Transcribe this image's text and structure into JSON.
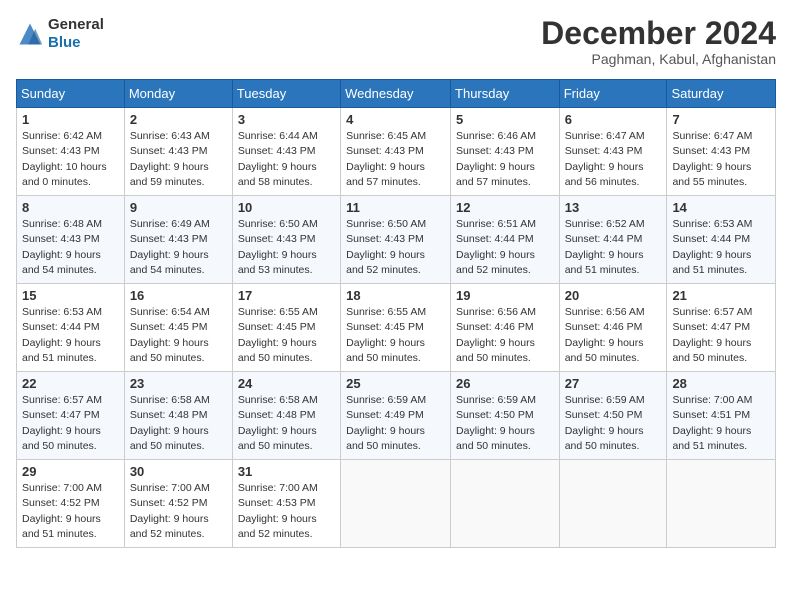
{
  "header": {
    "logo_line1": "General",
    "logo_line2": "Blue",
    "month": "December 2024",
    "location": "Paghman, Kabul, Afghanistan"
  },
  "weekdays": [
    "Sunday",
    "Monday",
    "Tuesday",
    "Wednesday",
    "Thursday",
    "Friday",
    "Saturday"
  ],
  "weeks": [
    [
      {
        "day": "1",
        "sunrise": "6:42 AM",
        "sunset": "4:43 PM",
        "daylight": "10 hours and 0 minutes."
      },
      {
        "day": "2",
        "sunrise": "6:43 AM",
        "sunset": "4:43 PM",
        "daylight": "9 hours and 59 minutes."
      },
      {
        "day": "3",
        "sunrise": "6:44 AM",
        "sunset": "4:43 PM",
        "daylight": "9 hours and 58 minutes."
      },
      {
        "day": "4",
        "sunrise": "6:45 AM",
        "sunset": "4:43 PM",
        "daylight": "9 hours and 57 minutes."
      },
      {
        "day": "5",
        "sunrise": "6:46 AM",
        "sunset": "4:43 PM",
        "daylight": "9 hours and 57 minutes."
      },
      {
        "day": "6",
        "sunrise": "6:47 AM",
        "sunset": "4:43 PM",
        "daylight": "9 hours and 56 minutes."
      },
      {
        "day": "7",
        "sunrise": "6:47 AM",
        "sunset": "4:43 PM",
        "daylight": "9 hours and 55 minutes."
      }
    ],
    [
      {
        "day": "8",
        "sunrise": "6:48 AM",
        "sunset": "4:43 PM",
        "daylight": "9 hours and 54 minutes."
      },
      {
        "day": "9",
        "sunrise": "6:49 AM",
        "sunset": "4:43 PM",
        "daylight": "9 hours and 54 minutes."
      },
      {
        "day": "10",
        "sunrise": "6:50 AM",
        "sunset": "4:43 PM",
        "daylight": "9 hours and 53 minutes."
      },
      {
        "day": "11",
        "sunrise": "6:50 AM",
        "sunset": "4:43 PM",
        "daylight": "9 hours and 52 minutes."
      },
      {
        "day": "12",
        "sunrise": "6:51 AM",
        "sunset": "4:44 PM",
        "daylight": "9 hours and 52 minutes."
      },
      {
        "day": "13",
        "sunrise": "6:52 AM",
        "sunset": "4:44 PM",
        "daylight": "9 hours and 51 minutes."
      },
      {
        "day": "14",
        "sunrise": "6:53 AM",
        "sunset": "4:44 PM",
        "daylight": "9 hours and 51 minutes."
      }
    ],
    [
      {
        "day": "15",
        "sunrise": "6:53 AM",
        "sunset": "4:44 PM",
        "daylight": "9 hours and 51 minutes."
      },
      {
        "day": "16",
        "sunrise": "6:54 AM",
        "sunset": "4:45 PM",
        "daylight": "9 hours and 50 minutes."
      },
      {
        "day": "17",
        "sunrise": "6:55 AM",
        "sunset": "4:45 PM",
        "daylight": "9 hours and 50 minutes."
      },
      {
        "day": "18",
        "sunrise": "6:55 AM",
        "sunset": "4:45 PM",
        "daylight": "9 hours and 50 minutes."
      },
      {
        "day": "19",
        "sunrise": "6:56 AM",
        "sunset": "4:46 PM",
        "daylight": "9 hours and 50 minutes."
      },
      {
        "day": "20",
        "sunrise": "6:56 AM",
        "sunset": "4:46 PM",
        "daylight": "9 hours and 50 minutes."
      },
      {
        "day": "21",
        "sunrise": "6:57 AM",
        "sunset": "4:47 PM",
        "daylight": "9 hours and 50 minutes."
      }
    ],
    [
      {
        "day": "22",
        "sunrise": "6:57 AM",
        "sunset": "4:47 PM",
        "daylight": "9 hours and 50 minutes."
      },
      {
        "day": "23",
        "sunrise": "6:58 AM",
        "sunset": "4:48 PM",
        "daylight": "9 hours and 50 minutes."
      },
      {
        "day": "24",
        "sunrise": "6:58 AM",
        "sunset": "4:48 PM",
        "daylight": "9 hours and 50 minutes."
      },
      {
        "day": "25",
        "sunrise": "6:59 AM",
        "sunset": "4:49 PM",
        "daylight": "9 hours and 50 minutes."
      },
      {
        "day": "26",
        "sunrise": "6:59 AM",
        "sunset": "4:50 PM",
        "daylight": "9 hours and 50 minutes."
      },
      {
        "day": "27",
        "sunrise": "6:59 AM",
        "sunset": "4:50 PM",
        "daylight": "9 hours and 50 minutes."
      },
      {
        "day": "28",
        "sunrise": "7:00 AM",
        "sunset": "4:51 PM",
        "daylight": "9 hours and 51 minutes."
      }
    ],
    [
      {
        "day": "29",
        "sunrise": "7:00 AM",
        "sunset": "4:52 PM",
        "daylight": "9 hours and 51 minutes."
      },
      {
        "day": "30",
        "sunrise": "7:00 AM",
        "sunset": "4:52 PM",
        "daylight": "9 hours and 52 minutes."
      },
      {
        "day": "31",
        "sunrise": "7:00 AM",
        "sunset": "4:53 PM",
        "daylight": "9 hours and 52 minutes."
      },
      null,
      null,
      null,
      null
    ]
  ]
}
